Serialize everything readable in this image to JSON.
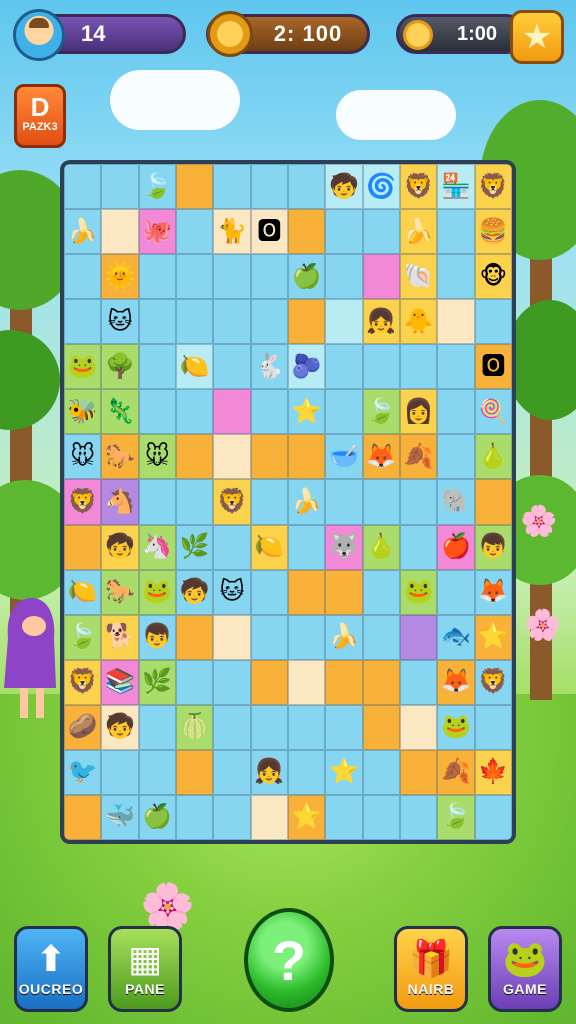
{
  "hud": {
    "lives": "14",
    "score": "2: 100",
    "timer": "1:00"
  },
  "level_button": {
    "big": "D",
    "small": "PAZK3"
  },
  "star_icon": "star-icon",
  "board": {
    "rows": [
      [
        "b:",
        "b:",
        "b:🍃",
        "o:",
        "b:",
        "b:",
        "b:",
        "l:🧒",
        "l:🌀",
        "y:🦁",
        "l:🏪",
        "y:🦁"
      ],
      [
        "b:🍌",
        "w:",
        "p:🐙",
        "b:",
        "w:🐈",
        "w:🅾",
        "o:",
        "b:",
        "b:",
        "y:🍌",
        "b:",
        "y:🍔"
      ],
      [
        "b:",
        "o:🌞",
        "b:",
        "b:",
        "b:",
        "b:",
        "b:🍏",
        "b:",
        "p:",
        "y:🐚",
        "b:",
        "y:🐵"
      ],
      [
        "b:",
        "b:🐱",
        "b:",
        "b:",
        "b:",
        "b:",
        "o:",
        "l:",
        "y:👧",
        "y:🐥",
        "w:",
        "b:"
      ],
      [
        "g:🐸",
        "g:🌳",
        "b:",
        "l:🍋",
        "b:",
        "b:🐇",
        "l:🫐",
        "b:",
        "b:",
        "b:",
        "b:",
        "o:🅾"
      ],
      [
        "g:🐝",
        "g:🦎",
        "b:",
        "b:",
        "p:",
        "b:",
        "b:⭐",
        "b:",
        "g:🍃",
        "y:👩",
        "b:",
        "b:🍭"
      ],
      [
        "b:🐭",
        "o:🐎",
        "g:🐭",
        "o:",
        "w:",
        "o:",
        "o:",
        "b:🥣",
        "o:🦊",
        "o:🍂",
        "b:",
        "g:🍐"
      ],
      [
        "p:🦁",
        "v:🐴",
        "b:",
        "b:",
        "y:🦁",
        "b:",
        "b:🍌",
        "b:",
        "b:",
        "b:",
        "b:🐘",
        "o:"
      ],
      [
        "o:",
        "y:🧒",
        "g:🦄",
        "b:🌿",
        "b:",
        "y:🍋",
        "b:",
        "p:🐺",
        "g:🍐",
        "b:",
        "p:🍎",
        "g:👦"
      ],
      [
        "b:🍋",
        "g:🐎",
        "g:🐸",
        "b:🧒",
        "b:🐱",
        "b:",
        "o:",
        "o:",
        "b:",
        "g:🐸",
        "b:",
        "b:🦊"
      ],
      [
        "g:🍃",
        "y:🐕",
        "b:👦",
        "o:",
        "w:",
        "b:",
        "b:",
        "b:🍌",
        "b:",
        "v:",
        "b:🐟",
        "o:⭐"
      ],
      [
        "y:🦁",
        "p:📚",
        "g:🌿",
        "b:",
        "b:",
        "o:",
        "w:",
        "o:",
        "o:",
        "b:",
        "o:🦊",
        "b:🦁"
      ],
      [
        "o:🥔",
        "w:🧒",
        "b:",
        "g:🍈",
        "b:",
        "b:",
        "b:",
        "b:",
        "o:",
        "w:",
        "b:🐸",
        "b:"
      ],
      [
        "b:🐦",
        "b:",
        "b:",
        "o:",
        "b:",
        "b:👧",
        "b:",
        "b:⭐",
        "b:",
        "o:",
        "o:🍂",
        "y:🍁"
      ],
      [
        "o:",
        "b:🐳",
        "b:🍏",
        "b:",
        "b:",
        "w:",
        "o:⭐",
        "b:",
        "b:",
        "b:",
        "g:🍃",
        "b:"
      ]
    ]
  },
  "buttons": {
    "b1": {
      "icon": "up-arrow-icon",
      "label": "OUCREO"
    },
    "b2": {
      "icon": "grid-icon",
      "label": "PANE"
    },
    "main": {
      "icon": "swirl-icon"
    },
    "b3": {
      "icon": "gift-box-icon",
      "label": "NAIRB"
    },
    "b4": {
      "icon": "pet-icon",
      "label": "GAME"
    }
  }
}
